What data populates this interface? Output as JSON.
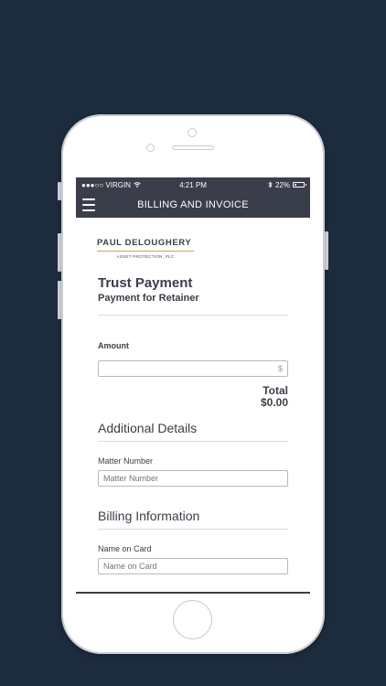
{
  "statusbar": {
    "carrier": "●●●○○ VIRGIN",
    "time": "4:21 PM",
    "battery": "22%",
    "battery_level": 0.22
  },
  "navbar": {
    "title": "BILLING AND INVOICE"
  },
  "logo": {
    "name": "PAUL DELOUGHERY",
    "sub": "ASSET PROTECTION, PLC"
  },
  "payment": {
    "title": "Trust Payment",
    "subtitle": "Payment for Retainer"
  },
  "amount": {
    "label": "Amount",
    "currency_symbol": "$",
    "total_label": "Total",
    "total_value": "$0.00"
  },
  "additional_details": {
    "heading": "Additional Details",
    "matter_number_label": "Matter Number",
    "matter_number_placeholder": "Matter Number"
  },
  "billing_information": {
    "heading": "Billing Information",
    "name_on_card_label": "Name on Card",
    "name_on_card_placeholder": "Name on Card"
  },
  "colors": {
    "background": "#1c2b3e",
    "bar": "#3a3e4a",
    "accent": "#c9a94e"
  }
}
